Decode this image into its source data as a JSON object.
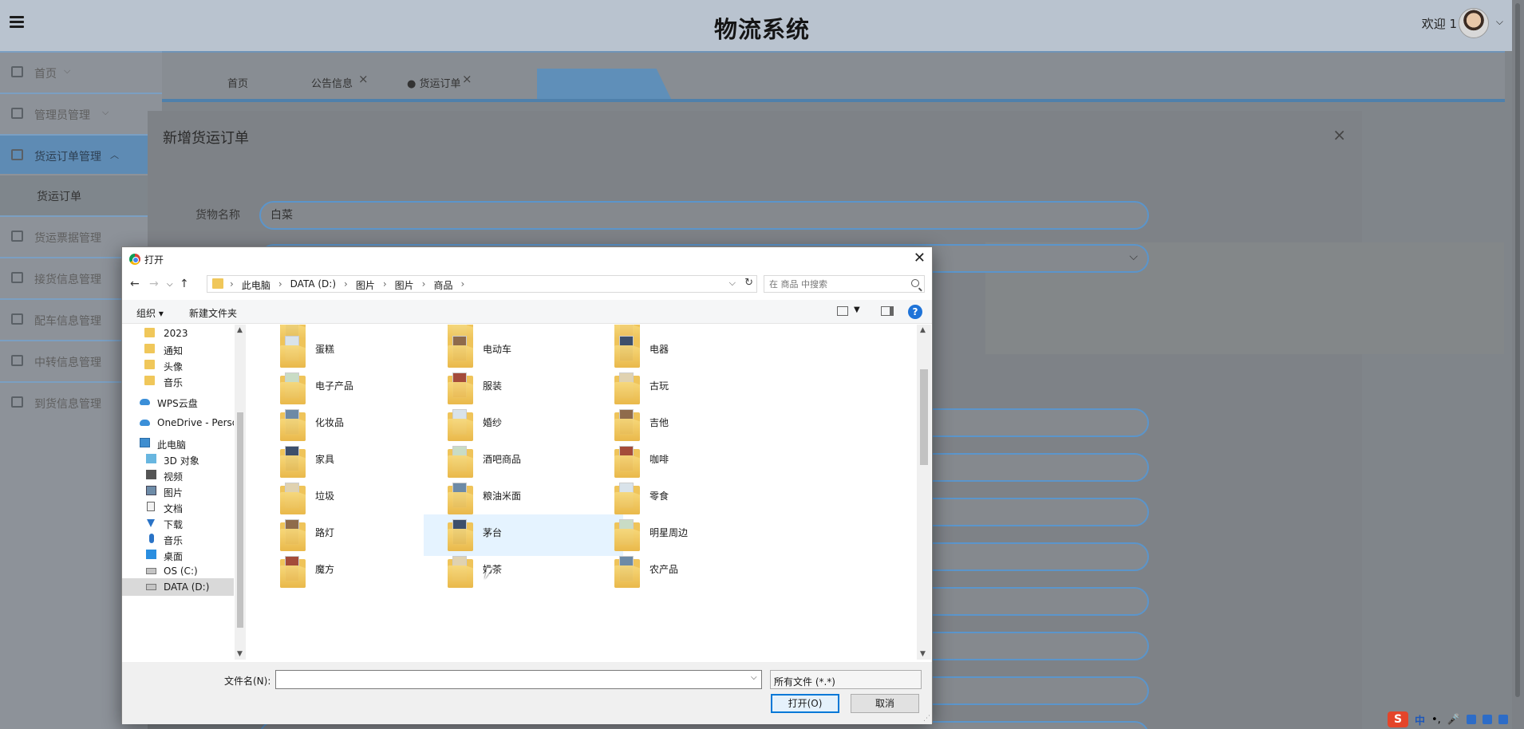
{
  "app": {
    "title": "物流系统",
    "welcome": "欢迎 1"
  },
  "sidebar": {
    "items": [
      {
        "label": "首页"
      },
      {
        "label": "管理员管理"
      },
      {
        "label": "货运订单管理"
      },
      {
        "label": "货运票据管理"
      },
      {
        "label": "接货信息管理"
      },
      {
        "label": "配车信息管理"
      },
      {
        "label": "中转信息管理"
      },
      {
        "label": "到货信息管理"
      }
    ],
    "sub_item": "货运订单"
  },
  "tabs": [
    {
      "label": "首页"
    },
    {
      "label": "公告信息"
    },
    {
      "label": "● 货运订单"
    }
  ],
  "modal": {
    "title": "新增货运订单",
    "field_label": "货物名称",
    "field_value": "白菜"
  },
  "dialog": {
    "title": "打开",
    "breadcrumbs": [
      "此电脑",
      "DATA (D:)",
      "图片",
      "图片",
      "商品"
    ],
    "search_placeholder": "在 商品 中搜索",
    "toolbar": {
      "organize": "组织 ▾",
      "new_folder": "新建文件夹",
      "help": "?"
    },
    "nav_items": [
      {
        "label": "2023",
        "icon": "folder-icon"
      },
      {
        "label": "通知",
        "icon": "folder-icon"
      },
      {
        "label": "头像",
        "icon": "folder-icon"
      },
      {
        "label": "音乐",
        "icon": "folder-icon"
      },
      {
        "label": "WPS云盘",
        "icon": "cloud-icon"
      },
      {
        "label": "OneDrive - Perso",
        "icon": "cloud-icon"
      },
      {
        "label": "此电脑",
        "icon": "pc-icon"
      },
      {
        "label": "3D 对象",
        "icon": "cube-icon"
      },
      {
        "label": "视频",
        "icon": "video-icon"
      },
      {
        "label": "图片",
        "icon": "pictures-icon"
      },
      {
        "label": "文档",
        "icon": "document-icon"
      },
      {
        "label": "下载",
        "icon": "download-icon"
      },
      {
        "label": "音乐",
        "icon": "music-icon"
      },
      {
        "label": "桌面",
        "icon": "desktop-icon"
      },
      {
        "label": "OS (C:)",
        "icon": "drive-icon"
      },
      {
        "label": "DATA (D:)",
        "icon": "drive-icon"
      }
    ],
    "folders": [
      "蛋糕",
      "电动车",
      "电器",
      "电子产品",
      "服装",
      "古玩",
      "化妆品",
      "婚纱",
      "吉他",
      "家具",
      "酒吧商品",
      "咖啡",
      "垃圾",
      "粮油米面",
      "零食",
      "路灯",
      "茅台",
      "明星周边",
      "魔方",
      "奶茶",
      "农产品"
    ],
    "selected_folder": "茅台",
    "filename_label": "文件名(N):",
    "filename_value": "",
    "filetype": "所有文件 (*.*)",
    "open_button": "打开(O)",
    "cancel_button": "取消"
  },
  "ime": {
    "label": "中"
  }
}
